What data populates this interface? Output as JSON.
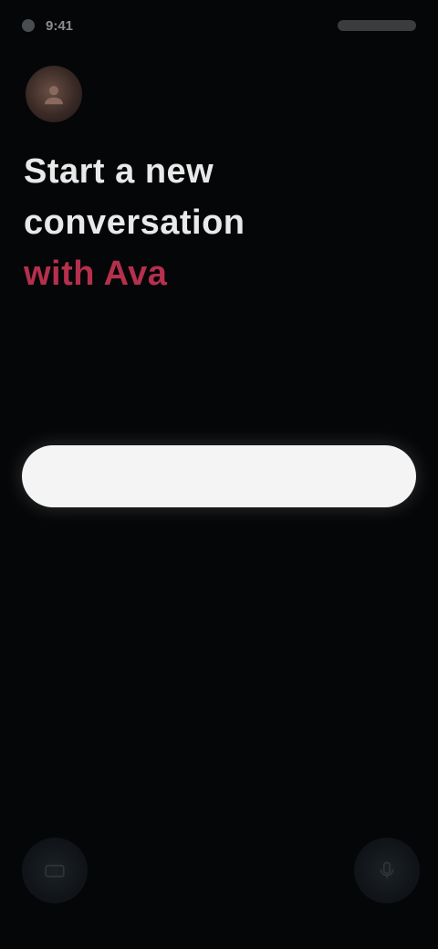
{
  "status_bar": {
    "time": "9:41",
    "right_label": ""
  },
  "headline": {
    "line1": "Start a new",
    "line2": "conversation",
    "accent": "with Ava"
  },
  "subtext": "",
  "primary_button": {
    "label": ""
  },
  "icons": {
    "avatar": "avatar-icon",
    "left_corner": "keyboard-icon",
    "right_corner": "microphone-icon"
  },
  "colors": {
    "background": "#050607",
    "accent": "#b5304d",
    "button": "#f4f4f4"
  }
}
